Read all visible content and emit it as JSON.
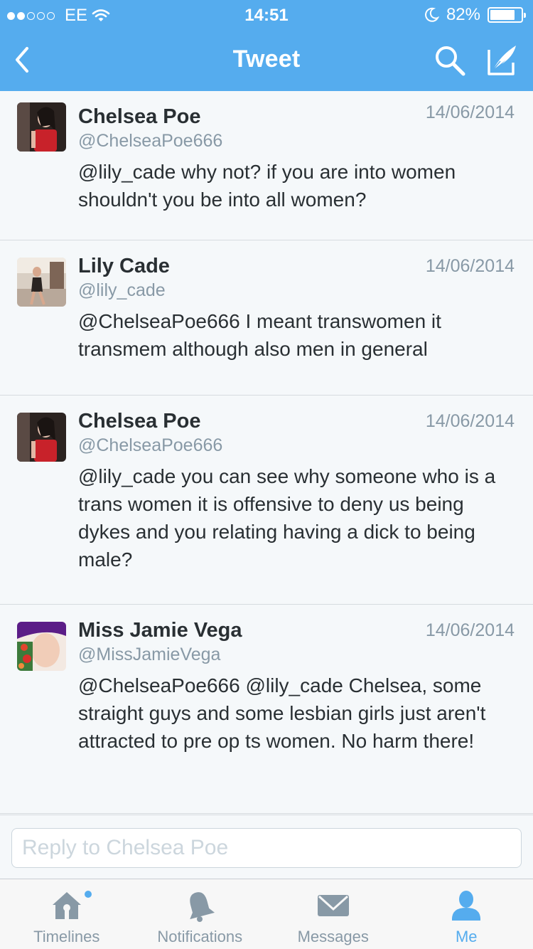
{
  "status_bar": {
    "carrier": "EE",
    "time": "14:51",
    "battery": "82%",
    "battery_level": 0.82,
    "signal_bars_filled": 2
  },
  "nav": {
    "title": "Tweet"
  },
  "tweets": [
    {
      "name": "Chelsea Poe",
      "handle": "@ChelseaPoe666",
      "date": "14/06/2014",
      "text": "@lily_cade why not? if you are into women shouldn't you be into all women?"
    },
    {
      "name": "Lily Cade",
      "handle": "@lily_cade",
      "date": "14/06/2014",
      "text": "@ChelseaPoe666 I meant transwomen it transmem although also men in general"
    },
    {
      "name": "Chelsea Poe",
      "handle": "@ChelseaPoe666",
      "date": "14/06/2014",
      "text": "@lily_cade you can see why someone who is a trans women it is offensive to deny us being dykes and you relating having a dick to being male?"
    },
    {
      "name": "Miss Jamie Vega",
      "handle": "@MissJamieVega",
      "date": "14/06/2014",
      "text": "@ChelseaPoe666 @lily_cade Chelsea, some straight guys and some lesbian girls just aren't attracted to pre op ts women. No harm there!"
    }
  ],
  "reply": {
    "placeholder": "Reply to Chelsea Poe",
    "value": ""
  },
  "tabs": [
    {
      "label": "Timelines",
      "icon": "home-icon",
      "active": false,
      "has_badge": true
    },
    {
      "label": "Notifications",
      "icon": "bell-icon",
      "active": false,
      "has_badge": false
    },
    {
      "label": "Messages",
      "icon": "envelope-icon",
      "active": false,
      "has_badge": false
    },
    {
      "label": "Me",
      "icon": "person-icon",
      "active": true,
      "has_badge": false
    }
  ],
  "colors": {
    "brand": "#55acee",
    "text": "#292f33",
    "muted": "#8899a6",
    "background": "#f5f8fa"
  }
}
